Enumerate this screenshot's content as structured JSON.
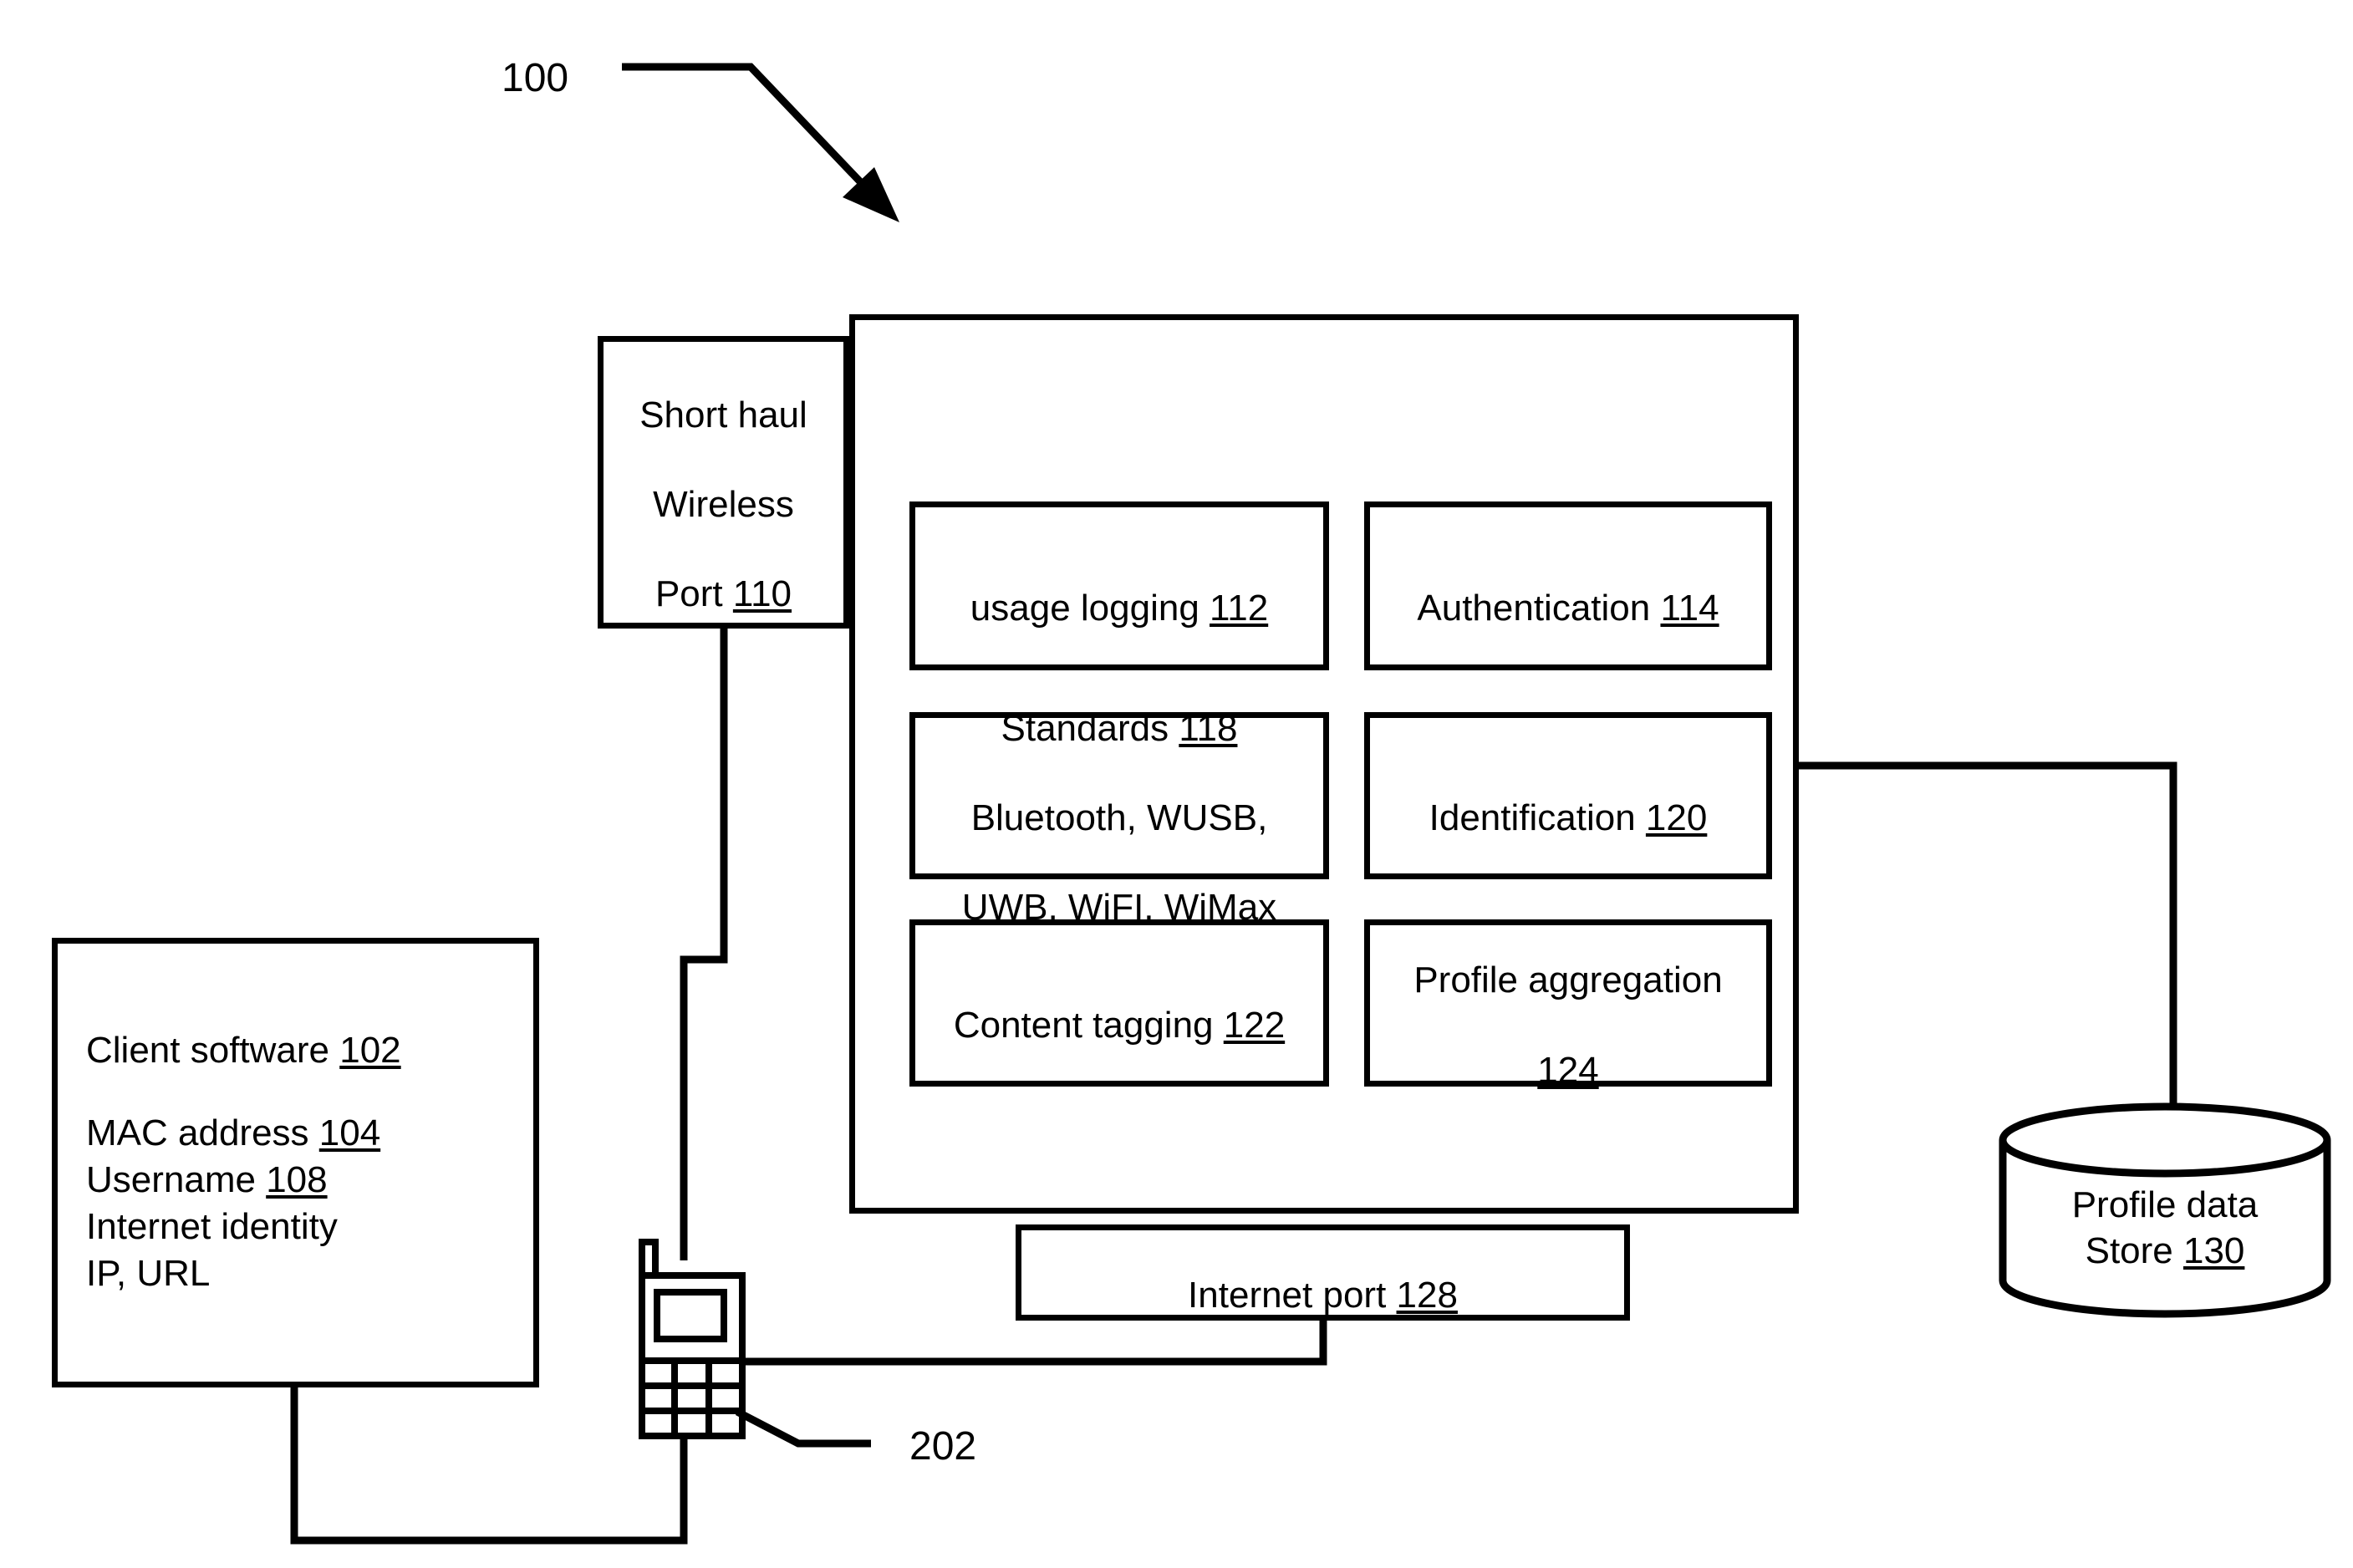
{
  "figure": {
    "number": "100",
    "secondary_number": "202"
  },
  "boxes": {
    "short_haul": {
      "line1": "Short haul",
      "line2": "Wireless",
      "line3_text": "Port ",
      "line3_ref": "110"
    },
    "usage_logging": {
      "text": "usage logging ",
      "ref": "112"
    },
    "authentication": {
      "text": "Authentication ",
      "ref": "114"
    },
    "standards": {
      "line1_text": "Standards ",
      "line1_ref": "118",
      "line2": "Bluetooth, WUSB,",
      "line3": "UWB, WiFI, WiMax"
    },
    "identification": {
      "text": "Identification ",
      "ref": "120"
    },
    "content_tagging": {
      "text": "Content tagging ",
      "ref": "122"
    },
    "profile_aggregation": {
      "line1": "Profile aggregation",
      "line2_ref": "124"
    },
    "internet_port": {
      "text": "Internet port ",
      "ref": "128"
    },
    "client_software": {
      "title_text": "Client software ",
      "title_ref": "102",
      "line_mac_text": "MAC address ",
      "line_mac_ref": "104",
      "line_username_text": "Username ",
      "line_username_ref": "108",
      "line_internet_identity": "Internet identity",
      "line_ip_url": "IP, URL"
    },
    "profile_data_store": {
      "line1": "Profile data",
      "line2_text": "Store ",
      "line2_ref": "130"
    }
  },
  "icons": {
    "mobile_phone": "mobile-phone-icon",
    "database_cylinder": "database-cylinder-icon",
    "figure_arrow": "figure-lead-arrow-icon"
  },
  "colors": {
    "stroke": "#000000",
    "fill": "#ffffff"
  }
}
